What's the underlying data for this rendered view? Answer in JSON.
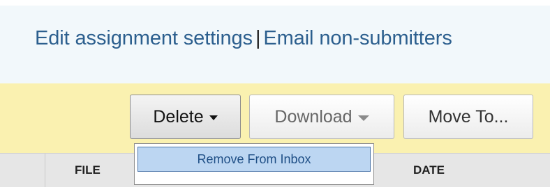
{
  "links": {
    "edit_settings": "Edit assignment settings",
    "separator": "|",
    "email_non_submitters": "Email non-submitters"
  },
  "toolbar": {
    "delete_label": "Delete",
    "download_label": "Download",
    "move_to_label": "Move To..."
  },
  "delete_menu": {
    "items": [
      {
        "label": "Remove From Inbox"
      }
    ]
  },
  "table_header": {
    "columns": [
      {
        "label": "FILE"
      },
      {
        "label": "DATE"
      }
    ]
  },
  "colors": {
    "link": "#2c5f8e",
    "links_bar_bg": "#f2f8fb",
    "action_bar_bg": "#faf1b0",
    "header_bg": "#e6e6e6",
    "menu_highlight": "#bcd6f2"
  },
  "icons": {
    "delete_caret": "caret-down-icon",
    "download_caret": "caret-down-icon"
  }
}
